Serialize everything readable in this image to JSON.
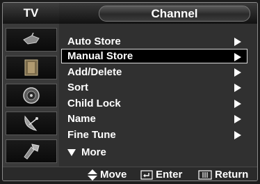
{
  "header": {
    "source_label": "TV",
    "title": "Channel"
  },
  "sidebar": {
    "items": [
      {
        "icon": "antenna-icon"
      },
      {
        "icon": "input-source-icon"
      },
      {
        "icon": "speaker-icon"
      },
      {
        "icon": "satellite-dish-icon"
      },
      {
        "icon": "setup-tools-icon"
      }
    ]
  },
  "menu": {
    "items": [
      {
        "label": "Auto Store",
        "has_submenu": true
      },
      {
        "label": "Manual Store",
        "has_submenu": true,
        "selected": true
      },
      {
        "label": "Add/Delete",
        "has_submenu": true
      },
      {
        "label": "Sort",
        "has_submenu": true
      },
      {
        "label": "Child Lock",
        "has_submenu": true
      },
      {
        "label": "Name",
        "has_submenu": true
      },
      {
        "label": "Fine Tune",
        "has_submenu": true
      }
    ],
    "more_label": "More"
  },
  "footer": {
    "move_label": "Move",
    "enter_label": "Enter",
    "return_label": "Return"
  },
  "colors": {
    "background": "#262626",
    "sidebar": "#3a3a3a",
    "menu": "#303030",
    "text": "#ffffff",
    "highlight_border": "#dcdcdc"
  }
}
